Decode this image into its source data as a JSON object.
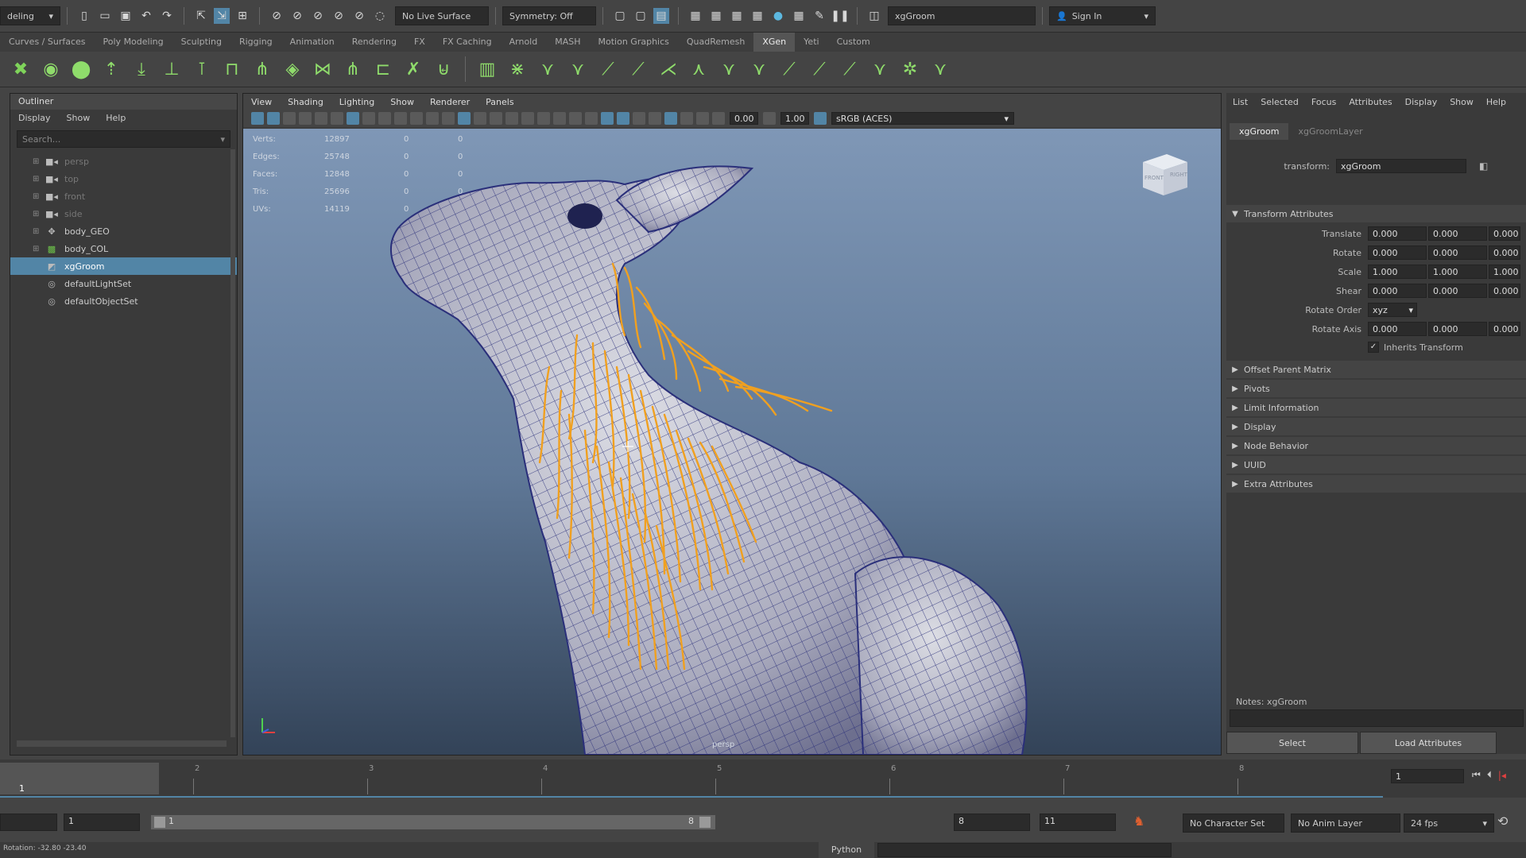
{
  "topbar": {
    "mode_menu": "deling",
    "live_surface": "No Live Surface",
    "symmetry": "Symmetry: Off",
    "search_value": "xgGroom",
    "sign_in": "Sign In"
  },
  "shelf_tabs": [
    "Curves / Surfaces",
    "Poly Modeling",
    "Sculpting",
    "Rigging",
    "Animation",
    "Rendering",
    "FX",
    "FX Caching",
    "Arnold",
    "MASH",
    "Motion Graphics",
    "QuadRemesh",
    "XGen",
    "Yeti",
    "Custom"
  ],
  "shelf_active": "XGen",
  "outliner": {
    "title": "Outliner",
    "menu": [
      "Display",
      "Show",
      "Help"
    ],
    "search_placeholder": "Search...",
    "items": [
      {
        "label": "persp",
        "icon": "camera-icon",
        "dim": true
      },
      {
        "label": "top",
        "icon": "camera-icon",
        "dim": true
      },
      {
        "label": "front",
        "icon": "camera-icon",
        "dim": true
      },
      {
        "label": "side",
        "icon": "camera-icon",
        "dim": true
      },
      {
        "label": "body_GEO",
        "icon": "mesh-icon",
        "dim": false
      },
      {
        "label": "body_COL",
        "icon": "collection-icon",
        "dim": false
      },
      {
        "label": "xgGroom",
        "icon": "groom-icon",
        "dim": false,
        "selected": true
      },
      {
        "label": "defaultLightSet",
        "icon": "set-icon",
        "dim": false
      },
      {
        "label": "defaultObjectSet",
        "icon": "set-icon",
        "dim": false
      }
    ]
  },
  "viewport": {
    "menu": [
      "View",
      "Shading",
      "Lighting",
      "Show",
      "Renderer",
      "Panels"
    ],
    "field_a": "0.00",
    "field_b": "1.00",
    "colorspace": "sRGB (ACES)",
    "hud": [
      {
        "label": "Verts:",
        "v1": "12897",
        "v2": "0",
        "v3": "0"
      },
      {
        "label": "Edges:",
        "v1": "25748",
        "v2": "0",
        "v3": "0"
      },
      {
        "label": "Faces:",
        "v1": "12848",
        "v2": "0",
        "v3": "0"
      },
      {
        "label": "Tris:",
        "v1": "25696",
        "v2": "0",
        "v3": "0"
      },
      {
        "label": "UVs:",
        "v1": "14119",
        "v2": "0",
        "v3": "0"
      }
    ],
    "camera_label": "persp",
    "cube_front": "FRONT",
    "cube_right": "RIGHT"
  },
  "attr": {
    "menu": [
      "List",
      "Selected",
      "Focus",
      "Attributes",
      "Display",
      "Show",
      "Help"
    ],
    "tabs": [
      "xgGroom",
      "xgGroomLayer"
    ],
    "transform_label": "transform:",
    "transform_value": "xgGroom",
    "section_title": "Transform Attributes",
    "rows": [
      {
        "label": "Translate",
        "v": [
          "0.000",
          "0.000",
          "0.000"
        ]
      },
      {
        "label": "Rotate",
        "v": [
          "0.000",
          "0.000",
          "0.000"
        ]
      },
      {
        "label": "Scale",
        "v": [
          "1.000",
          "1.000",
          "1.000"
        ]
      },
      {
        "label": "Shear",
        "v": [
          "0.000",
          "0.000",
          "0.000"
        ]
      }
    ],
    "rotate_order_label": "Rotate Order",
    "rotate_order_value": "xyz",
    "rotate_axis_label": "Rotate Axis",
    "rotate_axis": [
      "0.000",
      "0.000",
      "0.000"
    ],
    "inherits": "Inherits Transform",
    "sections": [
      "Offset Parent Matrix",
      "Pivots",
      "Limit Information",
      "Display",
      "Node Behavior",
      "UUID",
      "Extra Attributes"
    ],
    "notes": "Notes:  xgGroom",
    "select_btn": "Select",
    "load_btn": "Load Attributes"
  },
  "timeline": {
    "ticks": [
      "1",
      "2",
      "3",
      "4",
      "5",
      "6",
      "7",
      "8"
    ],
    "current": "1",
    "current_field": "1"
  },
  "range": {
    "start": "1",
    "range_start": "1",
    "range_end": "8",
    "end_a": "8",
    "end_b": "11",
    "character_set": "No Character Set",
    "anim_layer": "No Anim Layer",
    "fps": "24 fps"
  },
  "status": {
    "left": "Rotation:   -32.80    -23.40",
    "python": "Python"
  },
  "colors": {
    "selection": "#5285a6",
    "shelf_icon": "#8fdc6b",
    "wire": "#2a2f7a",
    "guides": "#f0a020"
  }
}
